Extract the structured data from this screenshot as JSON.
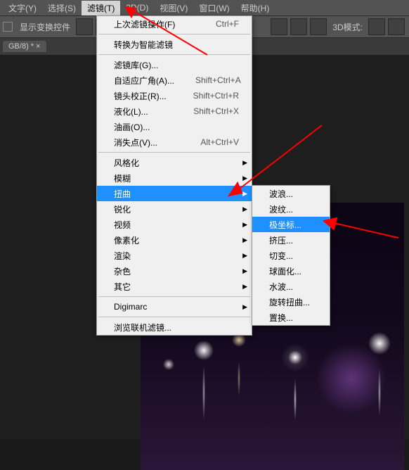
{
  "menubar": {
    "items": [
      {
        "label": "文字(Y)"
      },
      {
        "label": "选择(S)"
      },
      {
        "label": "滤镜(T)",
        "active": true
      },
      {
        "label": "3D(D)"
      },
      {
        "label": "视图(V)"
      },
      {
        "label": "窗口(W)"
      },
      {
        "label": "帮助(H)"
      }
    ]
  },
  "toolbar": {
    "show_transform_label": "显示变换控件",
    "mode_label": "3D模式:"
  },
  "tab": {
    "label": "GB/8) * ×"
  },
  "filter_menu": {
    "last_filter": {
      "label": "上次滤镜操作(F)",
      "shortcut": "Ctrl+F"
    },
    "convert_smart": {
      "label": "转换为智能滤镜"
    },
    "gallery": {
      "label": "滤镜库(G)..."
    },
    "adaptive": {
      "label": "自适应广角(A)...",
      "shortcut": "Shift+Ctrl+A"
    },
    "lens": {
      "label": "镜头校正(R)...",
      "shortcut": "Shift+Ctrl+R"
    },
    "liquify": {
      "label": "液化(L)...",
      "shortcut": "Shift+Ctrl+X"
    },
    "oil": {
      "label": "油画(O)..."
    },
    "vanish": {
      "label": "消失点(V)...",
      "shortcut": "Alt+Ctrl+V"
    },
    "stylize": {
      "label": "风格化"
    },
    "blur": {
      "label": "模糊"
    },
    "distort": {
      "label": "扭曲"
    },
    "sharpen": {
      "label": "锐化"
    },
    "video": {
      "label": "视频"
    },
    "pixelate": {
      "label": "像素化"
    },
    "render": {
      "label": "渲染"
    },
    "noise": {
      "label": "杂色"
    },
    "other": {
      "label": "其它"
    },
    "digimarc": {
      "label": "Digimarc"
    },
    "browse": {
      "label": "浏览联机滤镜..."
    }
  },
  "distort_submenu": {
    "wave": {
      "label": "波浪..."
    },
    "ripple": {
      "label": "波纹..."
    },
    "polar": {
      "label": "极坐标..."
    },
    "pinch": {
      "label": "挤压..."
    },
    "shear": {
      "label": "切变..."
    },
    "spherize": {
      "label": "球面化..."
    },
    "zigzag": {
      "label": "水波..."
    },
    "twirl": {
      "label": "旋转扭曲..."
    },
    "displace": {
      "label": "置换..."
    }
  }
}
